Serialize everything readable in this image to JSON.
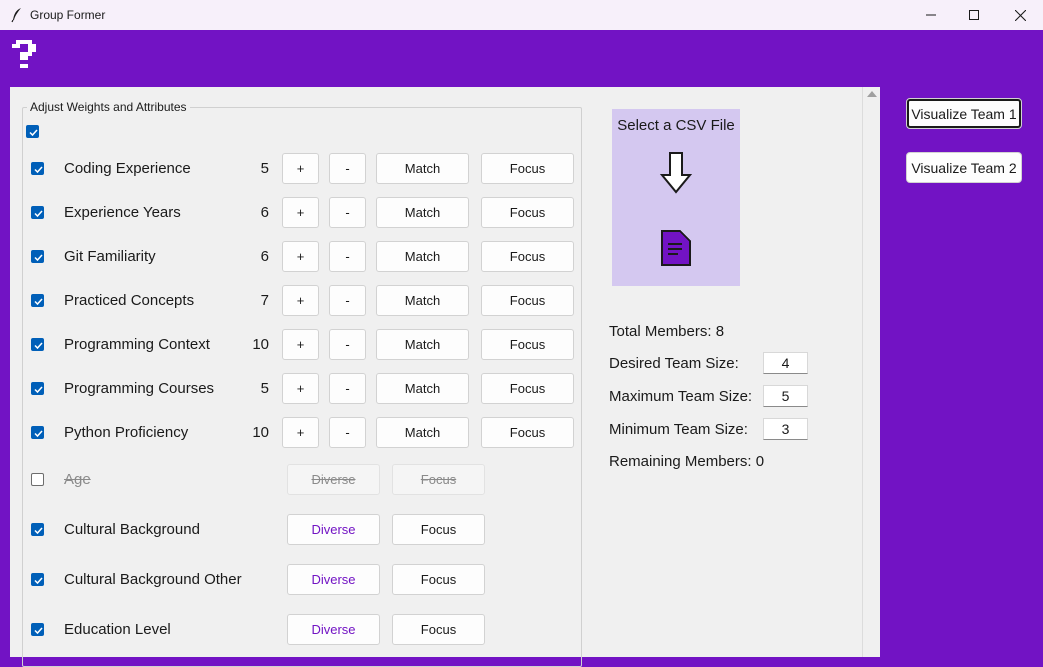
{
  "window": {
    "title": "Group Former",
    "minimize_icon": "minimize-icon",
    "maximize_icon": "maximize-icon",
    "close_icon": "close-icon"
  },
  "help_icon": "question-mark-icon",
  "panel": {
    "group_title": "Adjust Weights and Attributes",
    "select_all_checked": true,
    "numeric_attributes": [
      {
        "label": "Coding Experience",
        "weight": "5",
        "checked": true
      },
      {
        "label": "Experience Years",
        "weight": "6",
        "checked": true
      },
      {
        "label": "Git Familiarity",
        "weight": "6",
        "checked": true
      },
      {
        "label": "Practiced Concepts",
        "weight": "7",
        "checked": true
      },
      {
        "label": "Programming Context",
        "weight": "10",
        "checked": true
      },
      {
        "label": "Programming Courses",
        "weight": "5",
        "checked": true
      },
      {
        "label": "Python Proficiency",
        "weight": "10",
        "checked": true
      }
    ],
    "categorical_attributes": [
      {
        "label": "Age",
        "checked": false
      },
      {
        "label": "Cultural Background",
        "checked": true
      },
      {
        "label": "Cultural Background Other",
        "checked": true
      },
      {
        "label": "Education Level",
        "checked": true
      }
    ],
    "buttons": {
      "plus": "+",
      "minus": "-",
      "match": "Match",
      "focus": "Focus",
      "diverse": "Diverse"
    }
  },
  "csv": {
    "title": "Select a CSV File",
    "arrow_icon": "arrow-down-icon",
    "file_icon": "file-icon"
  },
  "stats": {
    "total_members": "Total Members: 8",
    "desired_label": "Desired Team Size:",
    "desired_value": "4",
    "maximum_label": "Maximum Team Size:",
    "maximum_value": "5",
    "minimum_label": "Minimum Team Size:",
    "minimum_value": "3",
    "remaining_members": "Remaining Members: 0"
  },
  "visualize": {
    "team1": "Visualize Team 1",
    "team2": "Visualize Team 2"
  },
  "colors": {
    "accent": "#7213c4",
    "csv_box": "#d4c8f0",
    "checkbox": "#005fb8"
  }
}
